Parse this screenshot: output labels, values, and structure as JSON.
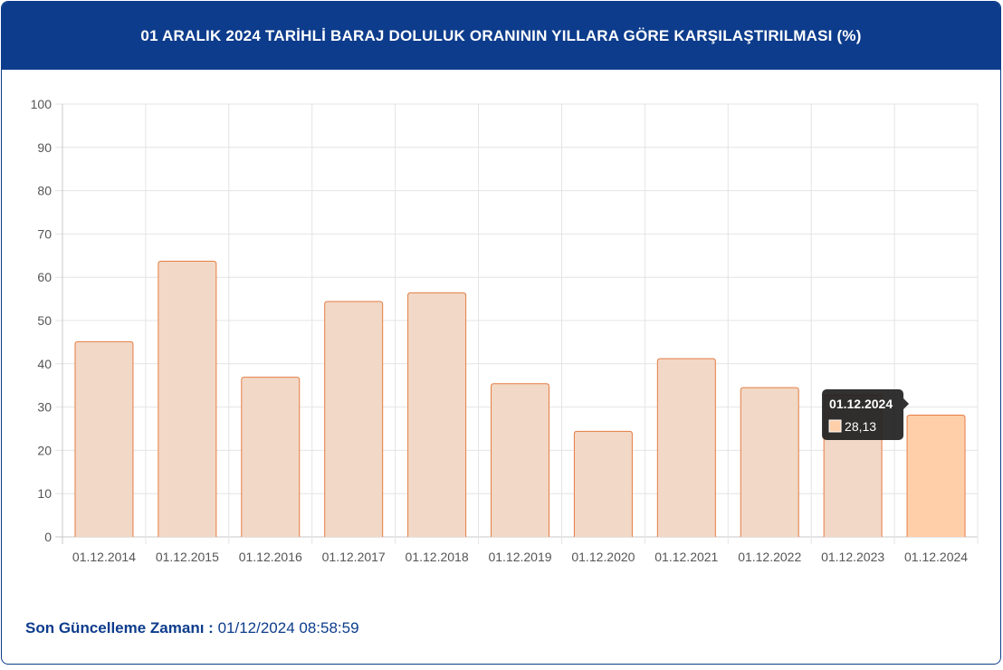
{
  "header": {
    "title": "01 ARALIK 2024 TARİHLİ BARAJ DOLULUK ORANININ YILLARA GÖRE KARŞILAŞTIRILMASI (%)"
  },
  "footer": {
    "label": "Son Güncelleme Zamanı",
    "separator": " : ",
    "value": "01/12/2024 08:58:59"
  },
  "colors": {
    "header_bg": "#0d3c8c",
    "bar_fill": "#f2d8c6",
    "bar_highlight_fill": "#ffcfaa",
    "bar_stroke": "#e57d45",
    "tooltip_bg": "#1f1f1f"
  },
  "chart_data": {
    "type": "bar",
    "title": "",
    "xlabel": "",
    "ylabel": "",
    "ylim": [
      0,
      100
    ],
    "yticks": [
      "0",
      "10",
      "20",
      "30",
      "40",
      "50",
      "60",
      "70",
      "80",
      "90",
      "100"
    ],
    "grid": true,
    "categories": [
      "01.12.2014",
      "01.12.2015",
      "01.12.2016",
      "01.12.2017",
      "01.12.2018",
      "01.12.2019",
      "01.12.2020",
      "01.12.2021",
      "01.12.2022",
      "01.12.2023",
      "01.12.2024"
    ],
    "values": [
      45.1,
      63.7,
      36.9,
      54.4,
      56.4,
      35.4,
      24.4,
      41.2,
      34.5,
      32.8,
      28.13
    ],
    "highlight_index": 10,
    "tooltip": {
      "title": "01.12.2024",
      "value": "28,13"
    }
  }
}
